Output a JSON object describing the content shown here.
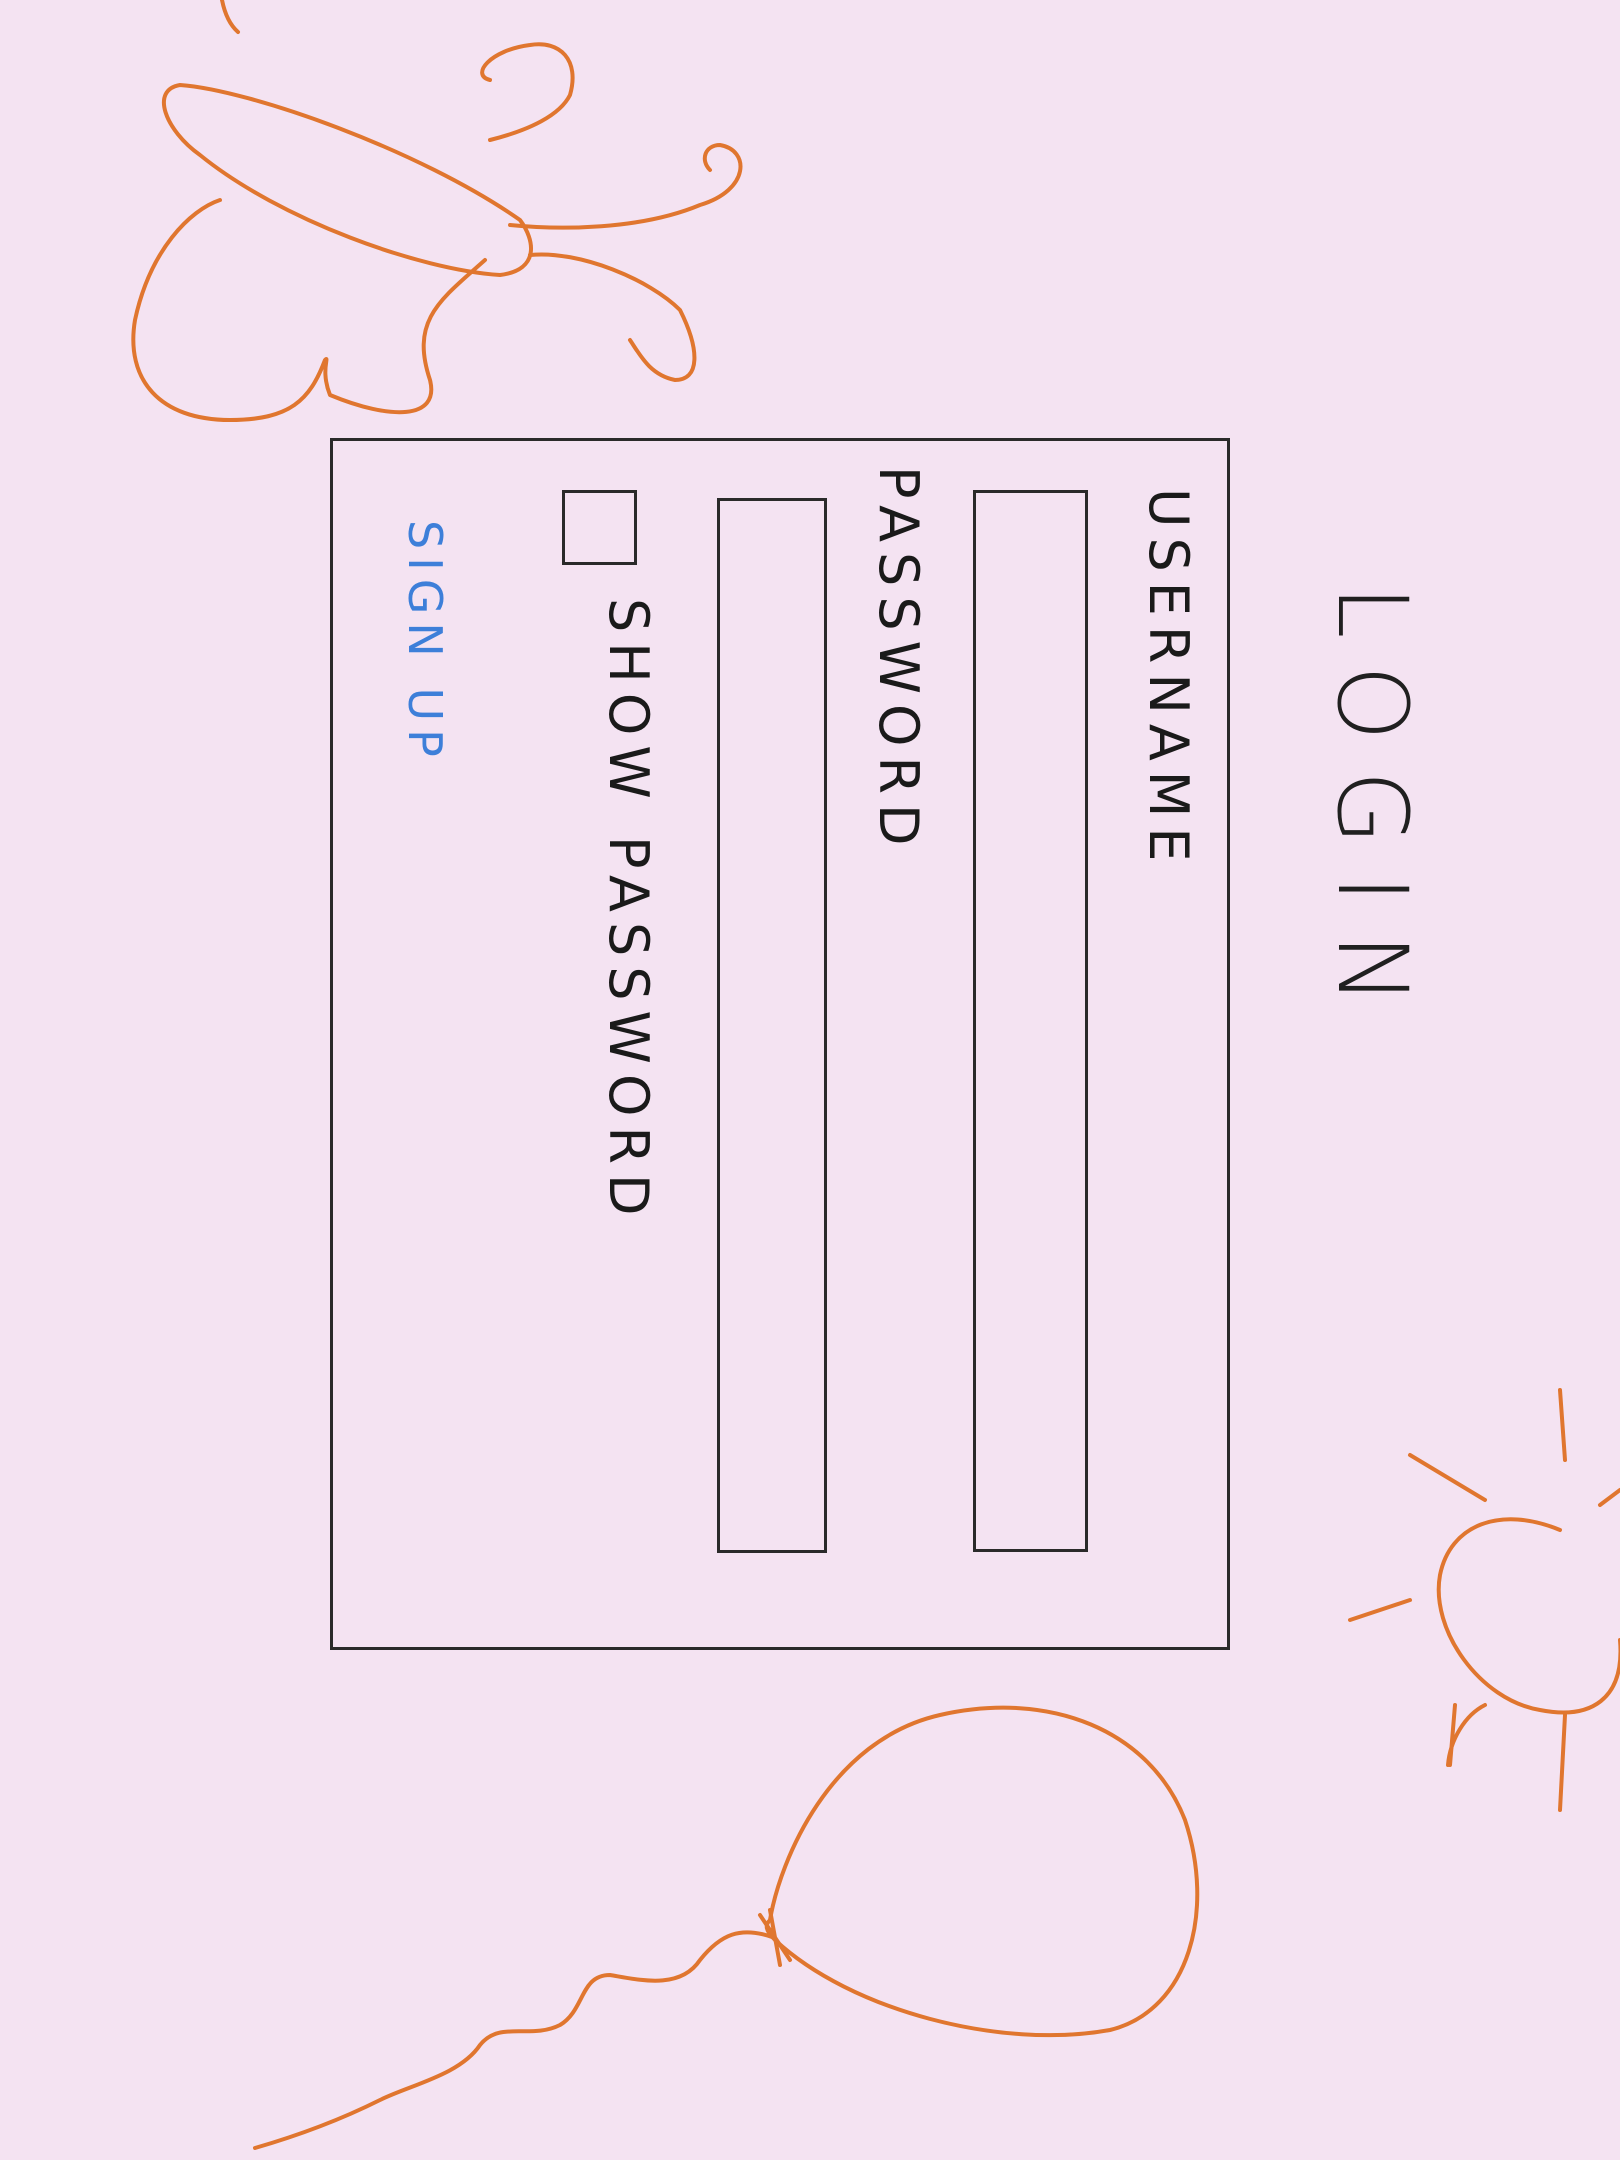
{
  "login": {
    "title": "LOGIN",
    "username_label": "USERNAME",
    "password_label": "PASSWORD",
    "show_password_label": "SHOW PASSWORD",
    "signup_link": "SIGN UP"
  },
  "colors": {
    "background": "#f4e3f2",
    "doodle": "#e0762f",
    "link": "#3d7fd9",
    "ink": "#2a2a2a"
  },
  "decorations": [
    "butterfly-doodle",
    "sun-doodle",
    "balloon-doodle"
  ]
}
